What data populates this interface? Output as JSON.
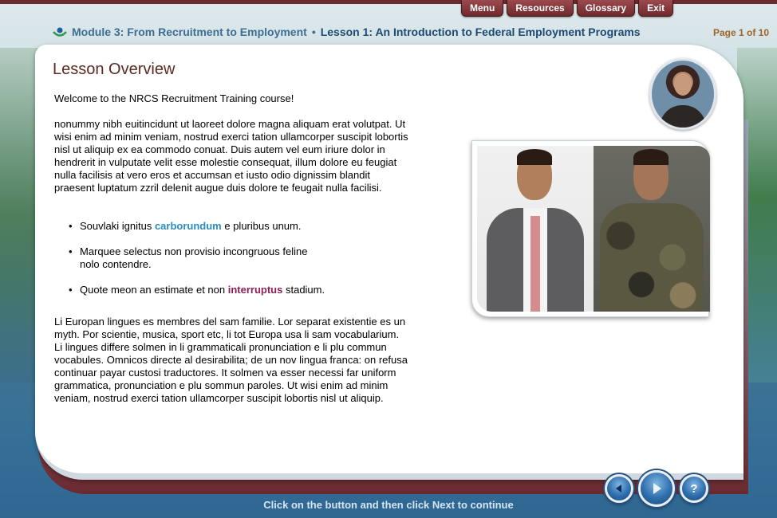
{
  "topnav": {
    "menu": "Menu",
    "resources": "Resources",
    "glossary": "Glossary",
    "exit": "Exit"
  },
  "header": {
    "module": "Module 3: From Recruitment to Employment",
    "separator": "•",
    "lesson": "Lesson 1: An Introduction to Federal Employment Programs",
    "page": "Page 1 of 10"
  },
  "content": {
    "title": "Lesson Overview",
    "welcome": "Welcome to the NRCS Recruitment Training course!",
    "paragraph1": "nonummy nibh euitincidunt ut laoreet dolore magna aliquam erat volutpat. Ut wisi enim ad minim veniam, nostrud exerci tation ullamcorper suscipit lobortis nisl ut aliquip ex ea commodo conuat. Duis autem vel eum iriure dolor in hendrerit in vulputate velit esse molestie consequat, illum dolore eu feugiat nulla facilisis at vero eros et accumsan et iusto odio dignissim blandit praesent luptatum zzril delenit augue duis dolore te feugait nulla facilisi.",
    "bullets": [
      {
        "before": "Souvlaki ignitus ",
        "highlight": "carborundum",
        "after": " e pluribus unum."
      },
      {
        "line1": "Marquee selectus non provisio incongruous feline",
        "line2": "nolo contendre."
      },
      {
        "before": "Quote meon an estimate et non ",
        "highlight": "interruptus",
        "after": " stadium."
      }
    ],
    "paragraph2": "Li Europan lingues es membres del sam familie. Lor separat existentie es un myth. Por scientie, musica, sport etc, li tot Europa usa li sam vocabularium. Li lingues differe solmen in li grammaticali pronunciation e li plu commun vocabules. Omnicos directe al desirabilita; de un nov lingua franca: on refusa continuar payar custosi traductores. It solmen va esser necessi far uniform grammatica, pronunciation e plu sommun paroles. Ut wisi enim ad minim veniam, nostrud exerci tation ullamcorper suscipit lobortis nisl ut aliquip."
  },
  "controls": {
    "help": "?"
  },
  "footer": {
    "instruction": "Click on the button and then click Next to continue"
  },
  "colors": {
    "maroon": "#6e2a2e",
    "blue": "#2a8bbf",
    "purple": "#8a1f58",
    "title_brown": "#5a2a1f",
    "page_orange": "#a0632a"
  },
  "icons": [
    "nrcs-logo-icon",
    "back-arrow-icon",
    "play-next-icon",
    "help-icon"
  ]
}
